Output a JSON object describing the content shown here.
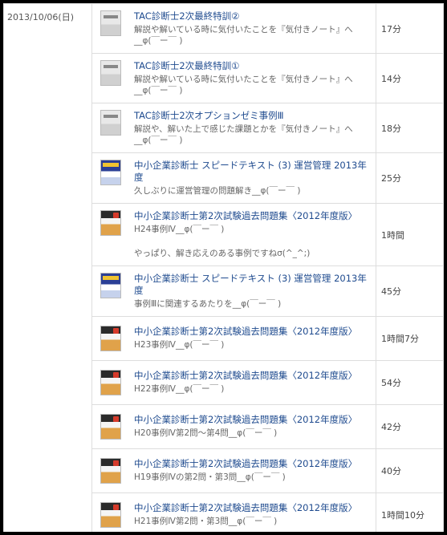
{
  "log": {
    "date": "2013/10/06(日)",
    "entries": [
      {
        "cover": "gray",
        "title": "TAC診断士2次最終特訓②",
        "note": "解説や解いている時に気付いたことを『気付きノート』へ__φ(￣ー￣ )",
        "comment": "",
        "time": "17分"
      },
      {
        "cover": "gray",
        "title": "TAC診断士2次最終特訓①",
        "note": "解説や解いている時に気付いたことを『気付きノート』へ__φ(￣ー￣ )",
        "comment": "",
        "time": "14分"
      },
      {
        "cover": "gray",
        "title": "TAC診断士2次オプションゼミ事例Ⅲ",
        "note": "解説や、解いた上で感じた課題とかを『気付きノート』へ__φ(￣ー￣ )",
        "comment": "",
        "time": "18分"
      },
      {
        "cover": "blue",
        "title": "中小企業診断士 スピードテキスト (3) 運営管理 2013年度",
        "note": "久しぶりに運営管理の問題解き__φ(￣ー￣ )",
        "comment": "",
        "time": "25分"
      },
      {
        "cover": "orange",
        "title": "中小企業診断士第2次試験過去問題集〈2012年度版〉",
        "note": "H24事例Ⅳ__φ(￣ー￣ )",
        "comment": "やっぱり、解き応えのある事例ですねσ(^_^;)",
        "time": "1時間"
      },
      {
        "cover": "blue",
        "title": "中小企業診断士 スピードテキスト (3) 運営管理 2013年度",
        "note": "事例Ⅲに関連するあたりを__φ(￣ー￣ )",
        "comment": "",
        "time": "45分"
      },
      {
        "cover": "orange",
        "title": "中小企業診断士第2次試験過去問題集〈2012年度版〉",
        "note": "H23事例Ⅳ__φ(￣ー￣ )",
        "comment": "",
        "time": "1時間7分"
      },
      {
        "cover": "orange",
        "title": "中小企業診断士第2次試験過去問題集〈2012年度版〉",
        "note": "H22事例Ⅳ__φ(￣ー￣ )",
        "comment": "",
        "time": "54分"
      },
      {
        "cover": "orange",
        "title": "中小企業診断士第2次試験過去問題集〈2012年度版〉",
        "note": "H20事例Ⅳ第2問～第4問__φ(￣ー￣ )",
        "comment": "",
        "time": "42分"
      },
      {
        "cover": "orange",
        "title": "中小企業診断士第2次試験過去問題集〈2012年度版〉",
        "note": "H19事例Ⅳの第2問・第3問__φ(￣ー￣ )",
        "comment": "",
        "time": "40分"
      },
      {
        "cover": "orange",
        "title": "中小企業診断士第2次試験過去問題集〈2012年度版〉",
        "note": "H21事例Ⅳ第2問・第3問__φ(￣ー￣ )",
        "comment": "",
        "time": "1時間10分"
      }
    ]
  }
}
